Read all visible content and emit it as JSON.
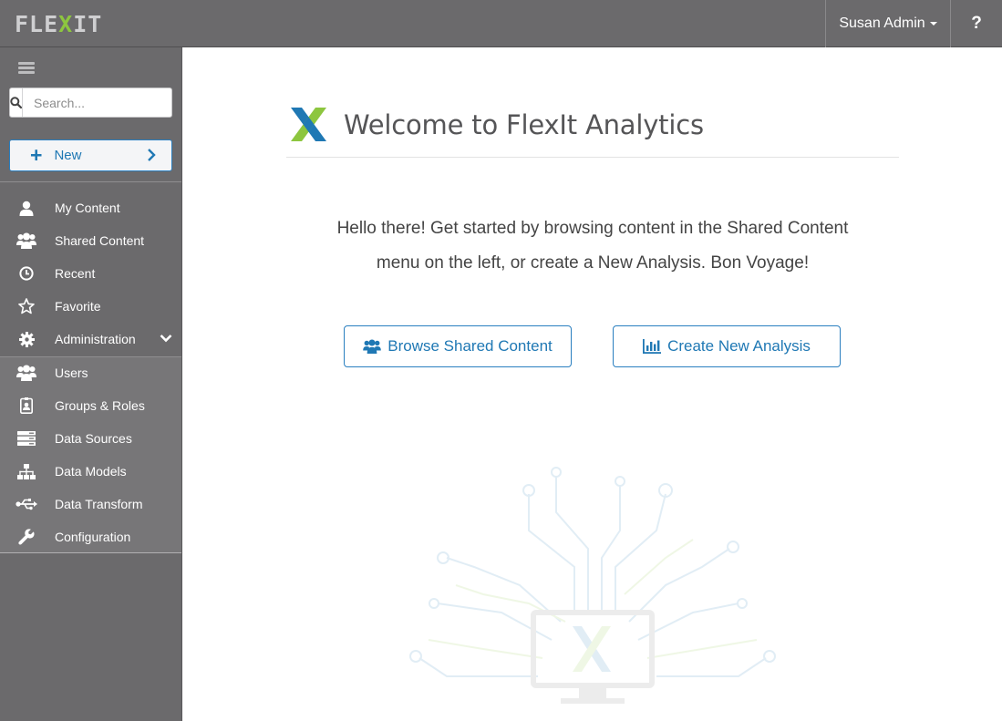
{
  "app": {
    "logo_text": "FLEXIT",
    "brand_colors": {
      "primary": "#1f78b4",
      "accent": "#8dc63f",
      "chrome": "#6b6a6c"
    }
  },
  "header": {
    "user_name": "Susan Admin",
    "help_label": "?"
  },
  "sidebar": {
    "search_placeholder": "Search...",
    "new_label": "New",
    "items": [
      {
        "label": "My Content",
        "icon": "user-icon"
      },
      {
        "label": "Shared Content",
        "icon": "users-icon"
      },
      {
        "label": "Recent",
        "icon": "clock-icon"
      },
      {
        "label": "Favorite",
        "icon": "star-icon"
      },
      {
        "label": "Administration",
        "icon": "gear-icon",
        "expanded": true
      }
    ],
    "admin_items": [
      {
        "label": "Users",
        "icon": "users-icon"
      },
      {
        "label": "Groups & Roles",
        "icon": "id-badge-icon"
      },
      {
        "label": "Data Sources",
        "icon": "server-icon"
      },
      {
        "label": "Data Models",
        "icon": "sitemap-icon"
      },
      {
        "label": "Data Transform",
        "icon": "usb-icon"
      },
      {
        "label": "Configuration",
        "icon": "wrench-icon"
      }
    ]
  },
  "main": {
    "title": "Welcome to FlexIt Analytics",
    "intro_line1": "Hello there! Get started by browsing content in the Shared Content",
    "intro_line2": "menu on the left, or create a New Analysis. Bon Voyage!",
    "browse_button": "Browse Shared Content",
    "create_button": "Create New Analysis"
  }
}
